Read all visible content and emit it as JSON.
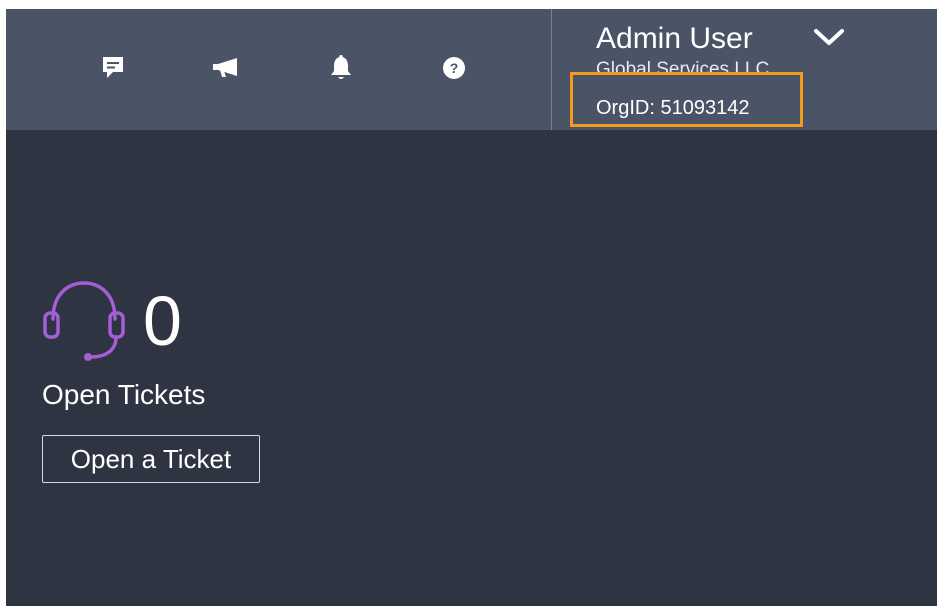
{
  "header": {
    "icons": [
      {
        "name": "chat-icon"
      },
      {
        "name": "megaphone-icon"
      },
      {
        "name": "bell-icon"
      },
      {
        "name": "help-icon"
      }
    ],
    "user": {
      "name": "Admin User",
      "org_name": "Global Services LLC",
      "org_id": "OrgID: 51093142"
    }
  },
  "tickets": {
    "count": "0",
    "label": "Open Tickets",
    "button_label": "Open a Ticket"
  },
  "colors": {
    "header_bg": "#4b5366",
    "content_bg": "#2f3442",
    "highlight": "#f39c1b",
    "headset_accent": "#a45fd6"
  }
}
